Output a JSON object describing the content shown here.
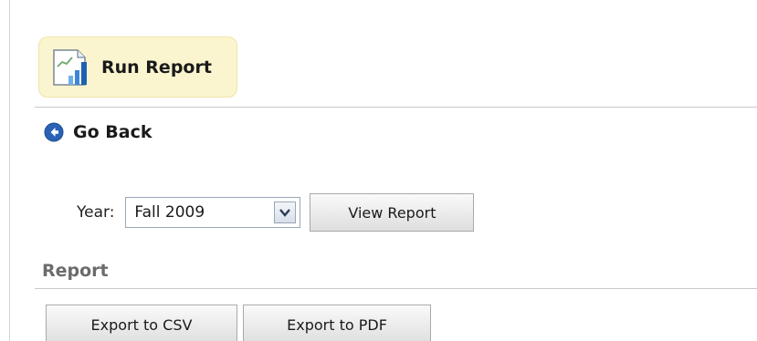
{
  "header": {
    "title": "Run Report",
    "icon": "bar-chart-report-icon"
  },
  "nav": {
    "go_back_label": "Go Back",
    "icon": "back-arrow-circle-icon"
  },
  "filters": {
    "year_label": "Year:",
    "year_selected": "Fall 2009",
    "view_button_label": "View Report"
  },
  "report": {
    "heading": "Report",
    "export_csv_label": "Export to CSV",
    "export_pdf_label": "Export to PDF"
  },
  "colors": {
    "header_bg": "#fbf5cf",
    "back_icon": "#2a62b5",
    "report_heading": "#6b6b6b"
  }
}
